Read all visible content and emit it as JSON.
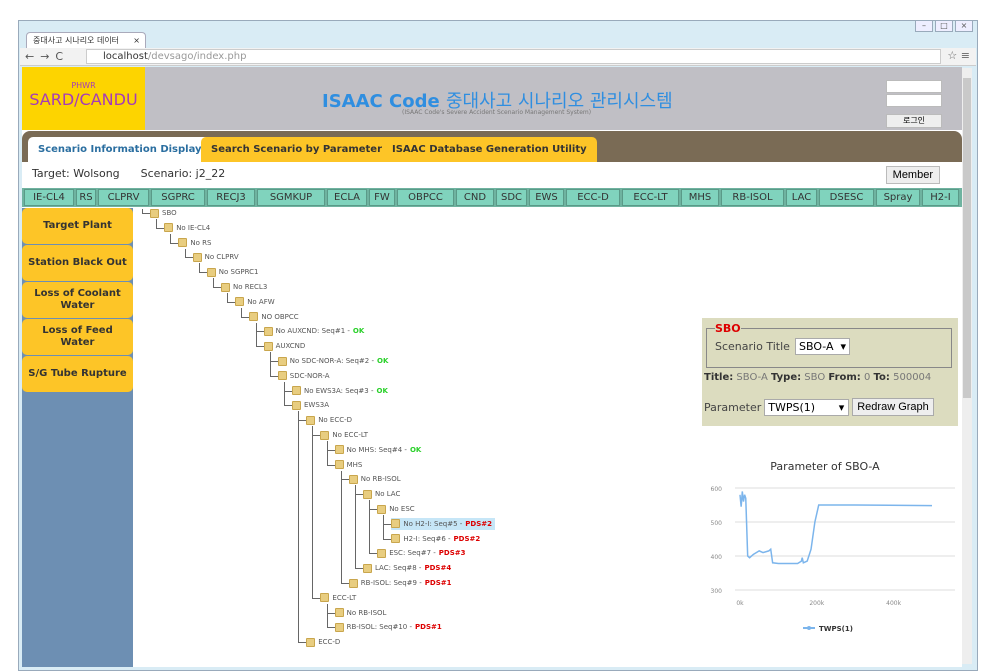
{
  "browser": {
    "tab_title": "중대사고 시나리오 데이터",
    "url_host": "localhost",
    "url_path": "/devsago/index.php"
  },
  "header": {
    "logo_small": "PHWR",
    "logo_main": "SARD/CANDU",
    "title_en": "ISAAC Code",
    "title_kr": "중대사고 시나리오 관리시스템",
    "subtitle": "(ISAAC Code's Severe Accident Scenario Management System)",
    "login_button": "로그인"
  },
  "main_tabs": [
    {
      "label": "Scenario Information Display",
      "active": true
    },
    {
      "label": "Search Scenario by Parameters"
    },
    {
      "label": "ISAAC Database Generation Utility"
    }
  ],
  "info": {
    "target": "Target: Wolsong",
    "scenario": "Scenario: j2_22",
    "member_button": "Member"
  },
  "codes": [
    "IE-CL4",
    "RS",
    "CLPRV",
    "SGPRC",
    "RECJ3",
    "SGMKUP",
    "ECLA",
    "FW",
    "OBPCC",
    "CND",
    "SDC",
    "EWS",
    "ECC-D",
    "ECC-LT",
    "MHS",
    "RB-ISOL",
    "LAC",
    "DSESC",
    "Spray",
    "H2-I"
  ],
  "sidebar": [
    "Target Plant",
    "Station Black Out",
    "Loss of Coolant Water",
    "Loss of Feed Water",
    "S/G Tube Rupture"
  ],
  "tree": [
    {
      "d": 0,
      "label": "SBO"
    },
    {
      "d": 1,
      "label": "No IE-CL4"
    },
    {
      "d": 2,
      "label": "No RS"
    },
    {
      "d": 3,
      "label": "No CLPRV"
    },
    {
      "d": 4,
      "label": "No SGPRC1"
    },
    {
      "d": 5,
      "label": "No RECL3"
    },
    {
      "d": 6,
      "label": "No AFW"
    },
    {
      "d": 7,
      "label": "NO OBPCC"
    },
    {
      "d": 8,
      "label": "No AUXCND: Seq#1 - ",
      "status": "OK"
    },
    {
      "d": 8,
      "label": "AUXCND"
    },
    {
      "d": 9,
      "label": "No SDC-NOR-A: Seq#2 - ",
      "status": "OK"
    },
    {
      "d": 9,
      "label": "SDC-NOR-A"
    },
    {
      "d": 10,
      "label": "No EWS3A: Seq#3 - ",
      "status": "OK"
    },
    {
      "d": 10,
      "label": "EWS3A"
    },
    {
      "d": 11,
      "label": "No ECC-D"
    },
    {
      "d": 12,
      "label": "No ECC-LT"
    },
    {
      "d": 13,
      "label": "No MHS: Seq#4 - ",
      "status": "OK"
    },
    {
      "d": 13,
      "label": "MHS"
    },
    {
      "d": 14,
      "label": "No RB-ISOL"
    },
    {
      "d": 15,
      "label": "No LAC"
    },
    {
      "d": 16,
      "label": "No ESC"
    },
    {
      "d": 17,
      "label": "No H2-I: Seq#5 - ",
      "status": "PDS#2",
      "selected": true
    },
    {
      "d": 17,
      "label": "H2-I: Seq#6 - ",
      "status": "PDS#2"
    },
    {
      "d": 16,
      "label": "ESC: Seq#7 - ",
      "status": "PDS#3"
    },
    {
      "d": 15,
      "label": "LAC: Seq#8 - ",
      "status": "PDS#4"
    },
    {
      "d": 14,
      "label": "RB-ISOL: Seq#9 - ",
      "status": "PDS#1"
    },
    {
      "d": 12,
      "label": "ECC-LT"
    },
    {
      "d": 13,
      "label": "No RB-ISOL"
    },
    {
      "d": 13,
      "label": "RB-ISOL: Seq#10 - ",
      "status": "PDS#1"
    },
    {
      "d": 11,
      "label": "ECC-D"
    }
  ],
  "panel": {
    "legend": "SBO",
    "scenario_title_label": "Scenario Title",
    "scenario_title_value": "SBO-A",
    "title_key": "Title:",
    "title_val": " SBO-A ",
    "type_key": "Type:",
    "type_val": " SBO ",
    "from_key": "From:",
    "from_val": " 0 ",
    "to_key": "To:",
    "to_val": " 500004",
    "parameter_label": "Parameter",
    "parameter_value": "TWPS(1)",
    "redraw_button": "Redraw Graph"
  },
  "chart_data": {
    "type": "line",
    "title": "Parameter of SBO-A",
    "xlim": [
      0,
      500000
    ],
    "ylim": [
      300,
      600
    ],
    "xticks": [
      "0k",
      "200k",
      "400k"
    ],
    "xtick_values": [
      0,
      200000,
      400000
    ],
    "yticks": [
      "300",
      "400",
      "500",
      "600"
    ],
    "grid": true,
    "legend": "bottom",
    "color": "#7cb5ec",
    "series": [
      {
        "name": "TWPS(1)",
        "x": [
          0,
          3000,
          6000,
          9000,
          12000,
          15000,
          20000,
          25000,
          35000,
          50000,
          60000,
          75000,
          80000,
          85000,
          100000,
          150000,
          160000,
          162000,
          165000,
          175000,
          185000,
          195000,
          205000,
          300000,
          500000
        ],
        "y": [
          580,
          545,
          590,
          560,
          580,
          570,
          400,
          395,
          405,
          415,
          410,
          415,
          420,
          380,
          378,
          378,
          385,
          395,
          380,
          385,
          420,
          500,
          550,
          550,
          548
        ]
      }
    ]
  }
}
